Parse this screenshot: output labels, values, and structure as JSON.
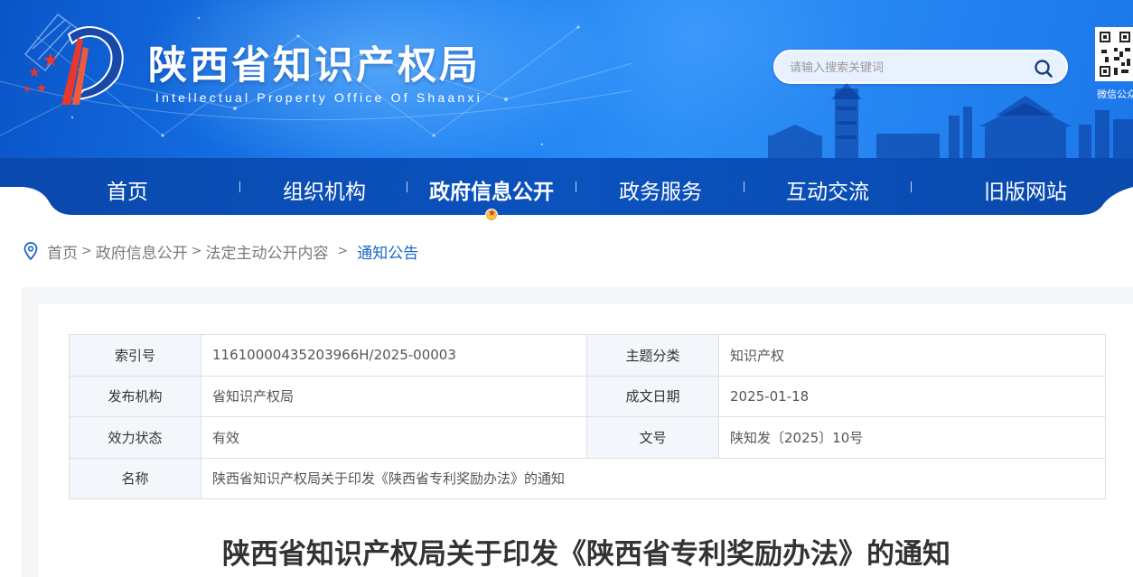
{
  "header": {
    "site_title": "陕西省知识产权局",
    "site_subtitle": "Intellectual Property Office Of Shaanxi",
    "search": {
      "placeholder": "请输入搜索关键词"
    },
    "qr_label": "微信公众"
  },
  "nav": {
    "items": [
      {
        "label": "首页"
      },
      {
        "label": "组织机构"
      },
      {
        "label": "政府信息公开",
        "active": true
      },
      {
        "label": "政务服务"
      },
      {
        "label": "互动交流"
      },
      {
        "label": "旧版网站"
      }
    ]
  },
  "breadcrumb": {
    "items": [
      "首页",
      "政府信息公开",
      "法定主动公开内容",
      "通知公告"
    ],
    "separators": [
      ">",
      ">",
      ">"
    ]
  },
  "meta_table": {
    "rows": [
      {
        "k1": "索引号",
        "v1": "11610000435203966H/2025-00003",
        "k2": "主题分类",
        "v2": "知识产权"
      },
      {
        "k1": "发布机构",
        "v1": "省知识产权局",
        "k2": "成文日期",
        "v2": "2025-01-18"
      },
      {
        "k1": "效力状态",
        "v1": "有效",
        "k2": "文号",
        "v2": "陕知发〔2025〕10号"
      },
      {
        "k1": "名称",
        "v1": "陕西省知识产权局关于印发《陕西省专利奖励办法》的通知"
      }
    ]
  },
  "document": {
    "title": "陕西省知识产权局关于印发《陕西省专利奖励办法》的通知"
  },
  "colors": {
    "banner_blue": "#1a7cf0",
    "nav_blue": "#0a4fb8",
    "link_blue": "#1a67c9",
    "star_red": "#e8382a"
  }
}
